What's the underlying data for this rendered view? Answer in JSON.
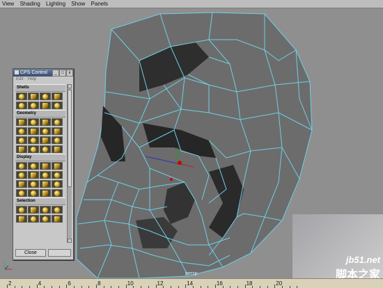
{
  "menubar": {
    "items": [
      "View",
      "Shading",
      "Lighting",
      "Show",
      "Panels"
    ]
  },
  "viewport": {
    "camera_label": "persp",
    "mesh_color": "#6c6c6c",
    "wire_color": "#6fd0e6",
    "background": "#8f8f8f"
  },
  "ruler": {
    "ticks": [
      "2",
      "4",
      "6",
      "8",
      "10",
      "12",
      "14",
      "16",
      "18",
      "20"
    ]
  },
  "cps": {
    "title": "CPS Control",
    "menu": [
      "Edit",
      "Help"
    ],
    "sections": [
      "Shells",
      "Geometry",
      "Display",
      "Selection"
    ],
    "close_label": "Close"
  },
  "watermark": {
    "line1": "jb51.net",
    "line2": "脚本之家"
  },
  "colors": {
    "accent_title": "#3b4d6e",
    "ruler_bg": "#d9d2b9",
    "icon_gold": "#c9a11a"
  }
}
